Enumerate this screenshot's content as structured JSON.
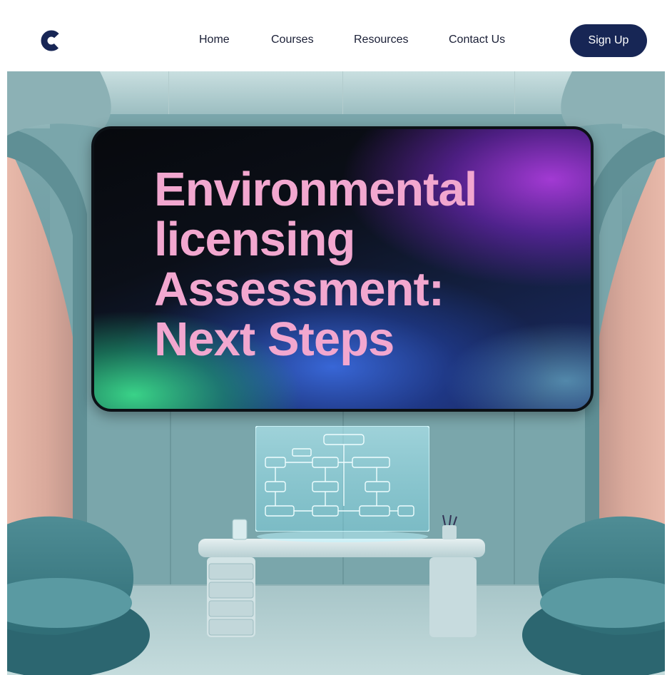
{
  "header": {
    "logo_letter": "C",
    "nav": [
      {
        "label": "Home"
      },
      {
        "label": "Courses"
      },
      {
        "label": "Resources"
      },
      {
        "label": "Contact Us"
      }
    ],
    "signup_label": "Sign Up"
  },
  "hero": {
    "headline_lines": [
      "Environmental",
      "licensing",
      "Assessment:",
      "Next Steps"
    ],
    "illustration": "futuristic-room-with-screen-desk-and-chairs"
  },
  "colors": {
    "brand_navy": "#172655",
    "headline_pink": "#f2a7cf",
    "nav_text": "#1a1f36"
  }
}
